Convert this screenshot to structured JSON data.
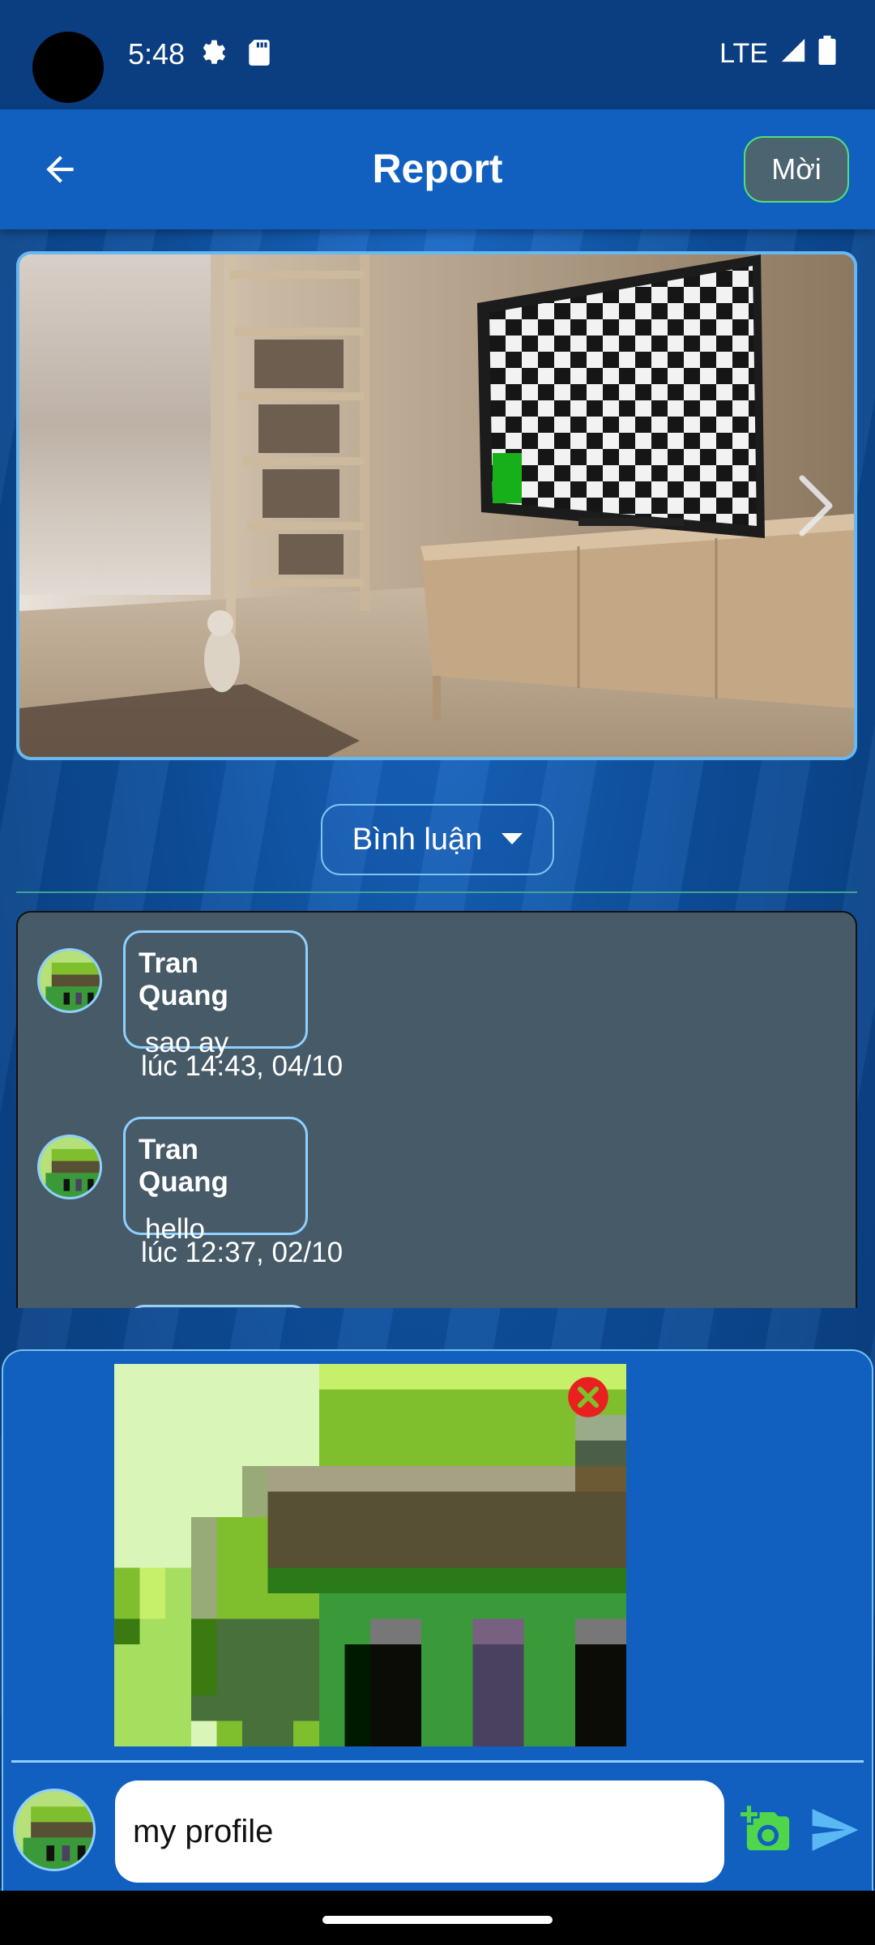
{
  "status_bar": {
    "time": "5:48",
    "network": "LTE",
    "icons": [
      "settings-icon",
      "sd-card-icon",
      "signal-icon",
      "battery-icon"
    ]
  },
  "app_bar": {
    "title": "Report",
    "invite_label": "Mời",
    "back_icon": "arrow-back-icon"
  },
  "viewer": {
    "next_icon": "chevron-right-icon"
  },
  "comments": {
    "dropdown_label": "Bình luận",
    "items": [
      {
        "author": "Tran Quang",
        "text": "sao ay",
        "time": "lúc 14:43, 04/10"
      },
      {
        "author": "Tran Quang",
        "text": "hello",
        "time": "lúc 12:37, 02/10"
      }
    ]
  },
  "composer": {
    "message": "my profile",
    "remove_icon": "close-icon",
    "camera_icon": "add-photo-icon",
    "send_icon": "send-icon"
  },
  "colors": {
    "app_bar": "#1160bf",
    "status_bar": "#0b3e80",
    "panel": "#475a68",
    "accent": "#8fd0ff",
    "camera_green": "#4fd64a",
    "send_blue": "#5ab8f5"
  }
}
